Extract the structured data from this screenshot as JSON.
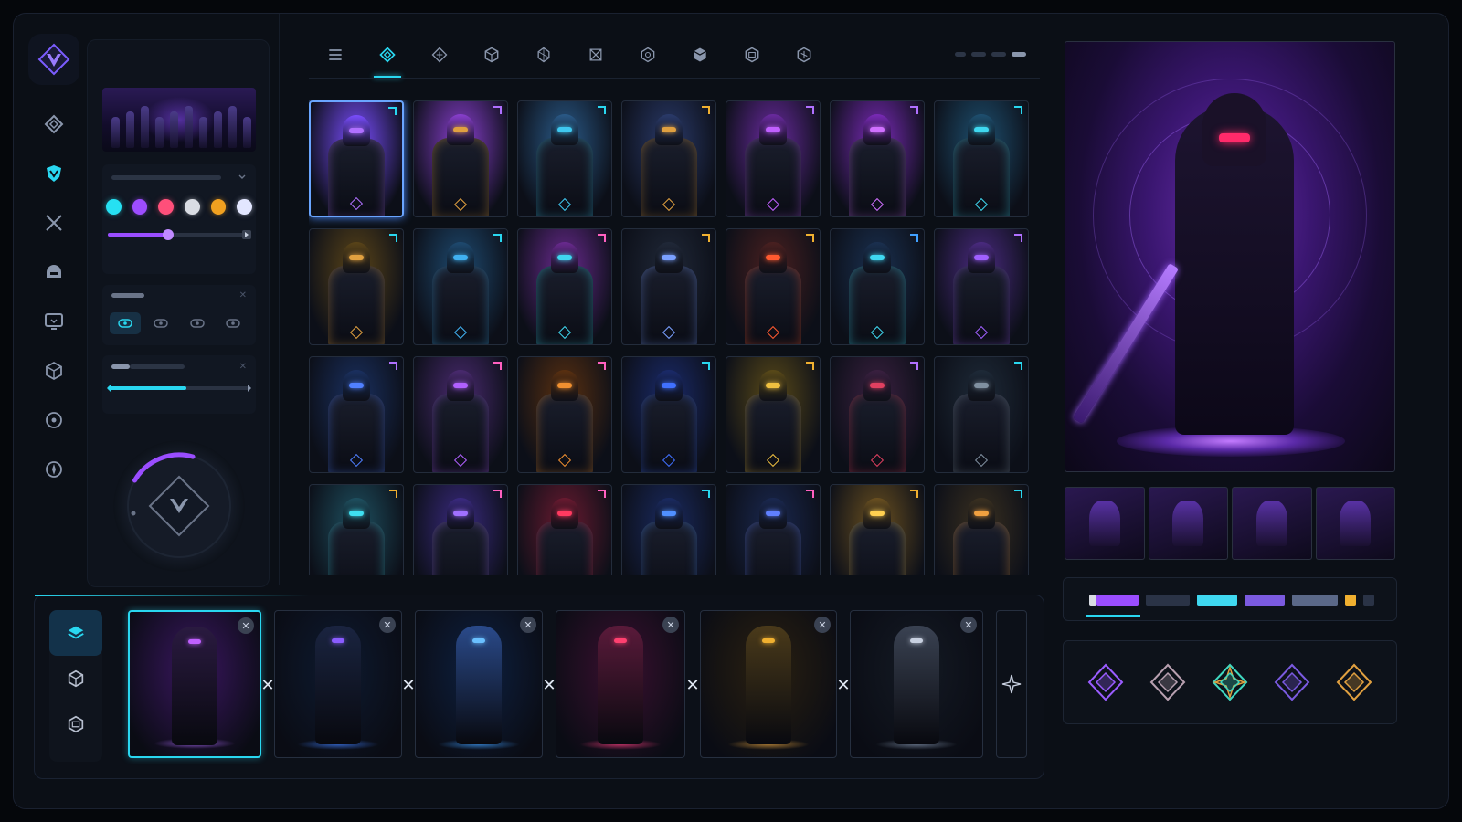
{
  "accent": "#29d7f0",
  "brand_purple": "#8a4dff",
  "rail": {
    "logo_icon": "chevron-v-logo",
    "items": [
      {
        "icon": "diamond-icon",
        "active": false
      },
      {
        "icon": "shield-icon",
        "active": true
      },
      {
        "icon": "crossed-swords-icon",
        "active": false
      },
      {
        "icon": "helmet-icon",
        "active": false
      },
      {
        "icon": "monitor-icon",
        "active": false
      },
      {
        "icon": "cube-icon",
        "active": false
      },
      {
        "icon": "target-icon",
        "active": false
      },
      {
        "icon": "compass-icon",
        "active": false
      }
    ]
  },
  "settings": {
    "swatches": [
      "#26e0f2",
      "#9d4dff",
      "#ff4f7a",
      "#d9dce3",
      "#f0a020",
      "#e2e6ff"
    ],
    "slider_1_value": 0.42,
    "slider_2_value": 0.55,
    "dial_value": 0.35
  },
  "tabs": [
    {
      "icon": "list-icon",
      "active": false
    },
    {
      "icon": "diamond-icon",
      "active": true
    },
    {
      "icon": "rune-icon",
      "active": false
    },
    {
      "icon": "cube-icon",
      "active": false
    },
    {
      "icon": "crystal-icon",
      "active": false
    },
    {
      "icon": "knot-icon",
      "active": false
    },
    {
      "icon": "gem-icon",
      "active": false
    },
    {
      "icon": "box-icon",
      "active": false
    },
    {
      "icon": "crate-icon",
      "active": false
    },
    {
      "icon": "hex-icon",
      "active": false
    }
  ],
  "grid": {
    "selected_index": 0,
    "cards": [
      {
        "theme": "#7a4dff",
        "glow": "#b070ff",
        "tag": "#29d7f0"
      },
      {
        "theme": "#8a3fd0",
        "glow": "#e0a040",
        "tag": "#b070ff"
      },
      {
        "theme": "#2a5a88",
        "glow": "#3fc8f0",
        "tag": "#29d7f0"
      },
      {
        "theme": "#2a3a6a",
        "glow": "#e0a040",
        "tag": "#f0b030"
      },
      {
        "theme": "#6a2aa0",
        "glow": "#c060ff",
        "tag": "#b070ff"
      },
      {
        "theme": "#7a2ab8",
        "glow": "#d070ff",
        "tag": "#b070ff"
      },
      {
        "theme": "#1e5070",
        "glow": "#3fd8f0",
        "tag": "#29d7f0"
      },
      {
        "theme": "#5a4418",
        "glow": "#e0a040",
        "tag": "#29d7f0"
      },
      {
        "theme": "#1e4a70",
        "glow": "#40b0f0",
        "tag": "#29d7f0"
      },
      {
        "theme": "#6a2a90",
        "glow": "#3fd8f0",
        "tag": "#ff60c0"
      },
      {
        "theme": "#202838",
        "glow": "#7aa0ff",
        "tag": "#f0b030"
      },
      {
        "theme": "#4a2020",
        "glow": "#ff5a30",
        "tag": "#f0b030"
      },
      {
        "theme": "#1a3050",
        "glow": "#3fd8f0",
        "tag": "#40a0ff"
      },
      {
        "theme": "#4a2a80",
        "glow": "#a060ff",
        "tag": "#b070ff"
      },
      {
        "theme": "#1a3060",
        "glow": "#5080ff",
        "tag": "#b070ff"
      },
      {
        "theme": "#4a2a70",
        "glow": "#b060ff",
        "tag": "#ff60c0"
      },
      {
        "theme": "#5a3010",
        "glow": "#f09030",
        "tag": "#ff60c0"
      },
      {
        "theme": "#1a2a6a",
        "glow": "#4070ff",
        "tag": "#29d7f0"
      },
      {
        "theme": "#5a4a18",
        "glow": "#f0c040",
        "tag": "#f0b030"
      },
      {
        "theme": "#3a2040",
        "glow": "#e04060",
        "tag": "#b070ff"
      },
      {
        "theme": "#1e2a38",
        "glow": "#8090a0",
        "tag": "#29d7f0"
      },
      {
        "theme": "#1e5060",
        "glow": "#3fe0f0",
        "tag": "#f0b030"
      },
      {
        "theme": "#3a2a80",
        "glow": "#a070ff",
        "tag": "#ff60c0"
      },
      {
        "theme": "#6a1a30",
        "glow": "#ff3a60",
        "tag": "#ff60c0"
      },
      {
        "theme": "#1a2a60",
        "glow": "#5090ff",
        "tag": "#29d7f0"
      },
      {
        "theme": "#1a2850",
        "glow": "#6080ff",
        "tag": "#ff60c0"
      },
      {
        "theme": "#6a5020",
        "glow": "#ffd050",
        "tag": "#f0b030"
      },
      {
        "theme": "#3a3020",
        "glow": "#f0a040",
        "tag": "#29d7f0"
      }
    ]
  },
  "preview": {
    "thumbs": [
      "blade-thumb",
      "armor-thumb",
      "hood-thumb",
      "emblem-thumb"
    ],
    "palette": [
      {
        "color": "#d9dce3",
        "w": 8
      },
      {
        "color": "#9a4dff",
        "w": 46
      },
      {
        "color": "#2a3346",
        "w": 48
      },
      {
        "color": "#3fd8f0",
        "w": 44
      },
      {
        "color": "#7a5ae0",
        "w": 44
      },
      {
        "color": "#5a6888",
        "w": 50
      },
      {
        "color": "#f0b030",
        "w": 12
      },
      {
        "color": "#2a3346",
        "w": 12
      }
    ],
    "emblems": [
      {
        "icon": "purple-crest-icon",
        "color": "#9a5cff"
      },
      {
        "icon": "silver-crest-icon",
        "color": "#b8a0b0"
      },
      {
        "icon": "teal-gold-crest-icon",
        "color": "#3fd8c0"
      },
      {
        "icon": "violet-shard-icon",
        "color": "#7a5ae0"
      },
      {
        "icon": "gold-rune-icon",
        "color": "#e0a040"
      }
    ]
  },
  "loadout": {
    "side_tabs": [
      {
        "icon": "layers-icon",
        "active": true
      },
      {
        "icon": "cube-icon",
        "active": false
      },
      {
        "icon": "crate-icon",
        "active": false
      }
    ],
    "close_glyph": "✕",
    "sep_glyph": "✕",
    "slots": [
      {
        "bg": "#3a1660",
        "fig": "#2a1a40",
        "face": "#c060ff",
        "plat": "#b070ff",
        "active": true
      },
      {
        "bg": "#0e1a30",
        "fig": "#1a2440",
        "face": "#8a5cff",
        "plat": "#4080ff",
        "active": false
      },
      {
        "bg": "#0e2040",
        "fig": "#2a4a8a",
        "face": "#6ac0ff",
        "plat": "#40a0ff",
        "active": false
      },
      {
        "bg": "#3a1030",
        "fig": "#5a1a3a",
        "face": "#ff4070",
        "plat": "#ff4080",
        "active": false
      },
      {
        "bg": "#2a2010",
        "fig": "#4a3a1a",
        "face": "#f0b030",
        "plat": "#e0a040",
        "active": false
      },
      {
        "bg": "#141a24",
        "fig": "#3a4252",
        "face": "#c8d0e0",
        "plat": "#8090a8",
        "active": false
      }
    ],
    "more_icon": "sparkle-icon"
  }
}
